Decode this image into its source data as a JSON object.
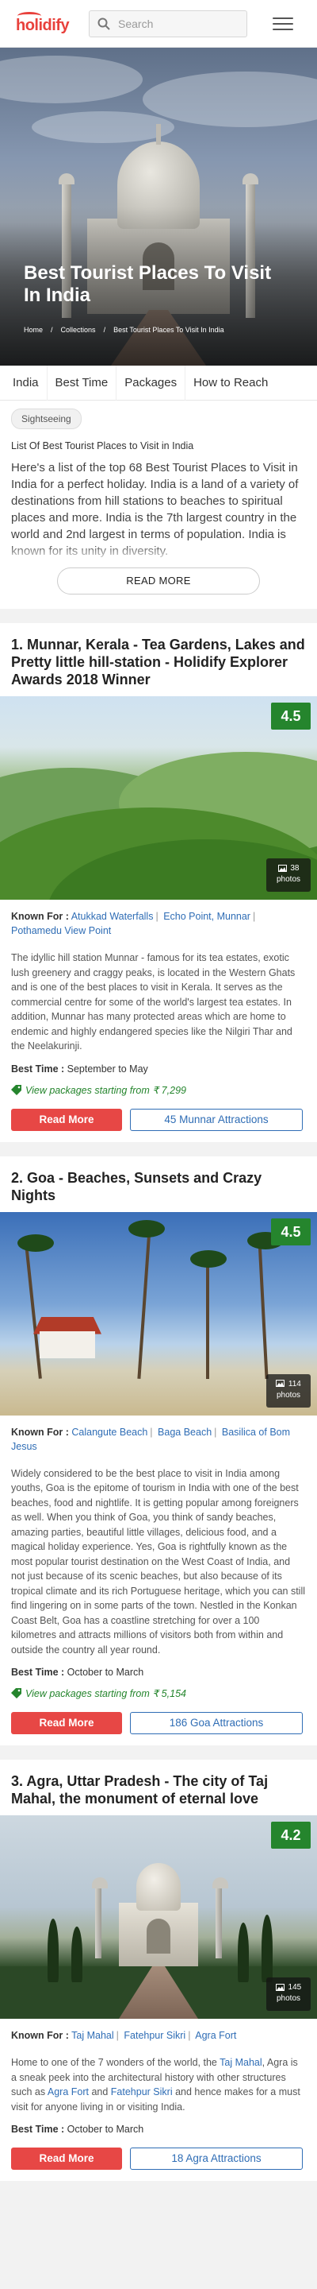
{
  "header": {
    "logo_text": "holidify",
    "search_placeholder": "Search"
  },
  "hero": {
    "title": "Best Tourist Places To Visit In India",
    "breadcrumb": [
      "Home",
      "Collections",
      "Best Tourist Places To Visit In India"
    ]
  },
  "tabs": [
    "India",
    "Best Time",
    "Packages",
    "How to Reach"
  ],
  "intro": {
    "chip": "Sightseeing",
    "subtitle": "List Of Best Tourist Places to Visit in India",
    "text": "Here's a list of the top 68 Best Tourist Places to Visit in India for a perfect holiday. India is a land of a variety of destinations from hill stations to beaches to spiritual places and more. India is the 7th largest country in the world and 2nd largest in terms of population. India is known for its unity in diversity.",
    "read_more": "READ MORE"
  },
  "places": [
    {
      "title": "1. Munnar, Kerala - Tea Gardens, Lakes and Pretty little hill-station - Holidify Explorer Awards 2018 Winner",
      "rating": "4.5",
      "photos_count": "38",
      "photos_label": "photos",
      "known_label": "Known For :",
      "known_for": [
        "Atukkad Waterfalls",
        "Echo Point, Munnar",
        "Pothamedu View Point"
      ],
      "description": "The idyllic hill station Munnar - famous for its tea estates, exotic lush greenery and craggy peaks, is located in the Western Ghats and is one of the best places to visit in Kerala. It serves as the commercial centre for some of the world's largest tea estates. In addition, Munnar has many protected areas which are home to endemic and highly endangered species like the Nilgiri Thar and the Neelakurinji.",
      "best_time_label": "Best Time :",
      "best_time": "September to May",
      "packages_text": "View packages starting from ₹ 7,299",
      "read_more": "Read More",
      "attractions": "45 Munnar Attractions"
    },
    {
      "title": "2. Goa - Beaches, Sunsets and Crazy Nights",
      "rating": "4.5",
      "photos_count": "114",
      "photos_label": "photos",
      "known_label": "Known For :",
      "known_for": [
        "Calangute Beach",
        "Baga Beach",
        "Basilica of Bom Jesus"
      ],
      "description": "Widely considered to be the best place to visit in India among youths, Goa is the epitome of tourism in India with one of the best beaches, food and nightlife. It is getting popular among foreigners as well. When you think of Goa, you think of sandy beaches, amazing parties, beautiful little villages, delicious food, and a magical holiday experience. Yes, Goa is rightfully known as the most popular tourist destination on the West Coast of India, and not just because of its scenic beaches, but also because of its tropical climate and its rich Portuguese heritage, which you can still find lingering on in some parts of the town. Nestled in the Konkan Coast Belt, Goa has a coastline stretching for over a 100 kilometres and attracts millions of visitors both from within and outside the country all year round.",
      "best_time_label": "Best Time :",
      "best_time": "October to March",
      "packages_text": "View packages starting from ₹ 5,154",
      "read_more": "Read More",
      "attractions": "186 Goa Attractions"
    },
    {
      "title": "3. Agra, Uttar Pradesh - The city of Taj Mahal, the monument of eternal love",
      "rating": "4.2",
      "photos_count": "145",
      "photos_label": "photos",
      "known_label": "Known For :",
      "known_for": [
        "Taj Mahal",
        "Fatehpur Sikri",
        "Agra Fort"
      ],
      "description_parts": [
        "Home to one of the 7 wonders of the world, the ",
        "Taj Mahal",
        ", Agra is a sneak peek into the architectural history with other structures such as ",
        "Agra Fort",
        " and ",
        "Fatehpur Sikri",
        " and hence makes for a must visit for anyone living in or visiting India."
      ],
      "best_time_label": "Best Time :",
      "best_time": "October to March",
      "read_more": "Read More",
      "attractions": "18 Agra Attractions"
    }
  ],
  "colors": {
    "brand_red": "#e8413c",
    "rating_green": "#25852d",
    "link_blue": "#2f6db5",
    "read_more_red": "#e74745"
  }
}
